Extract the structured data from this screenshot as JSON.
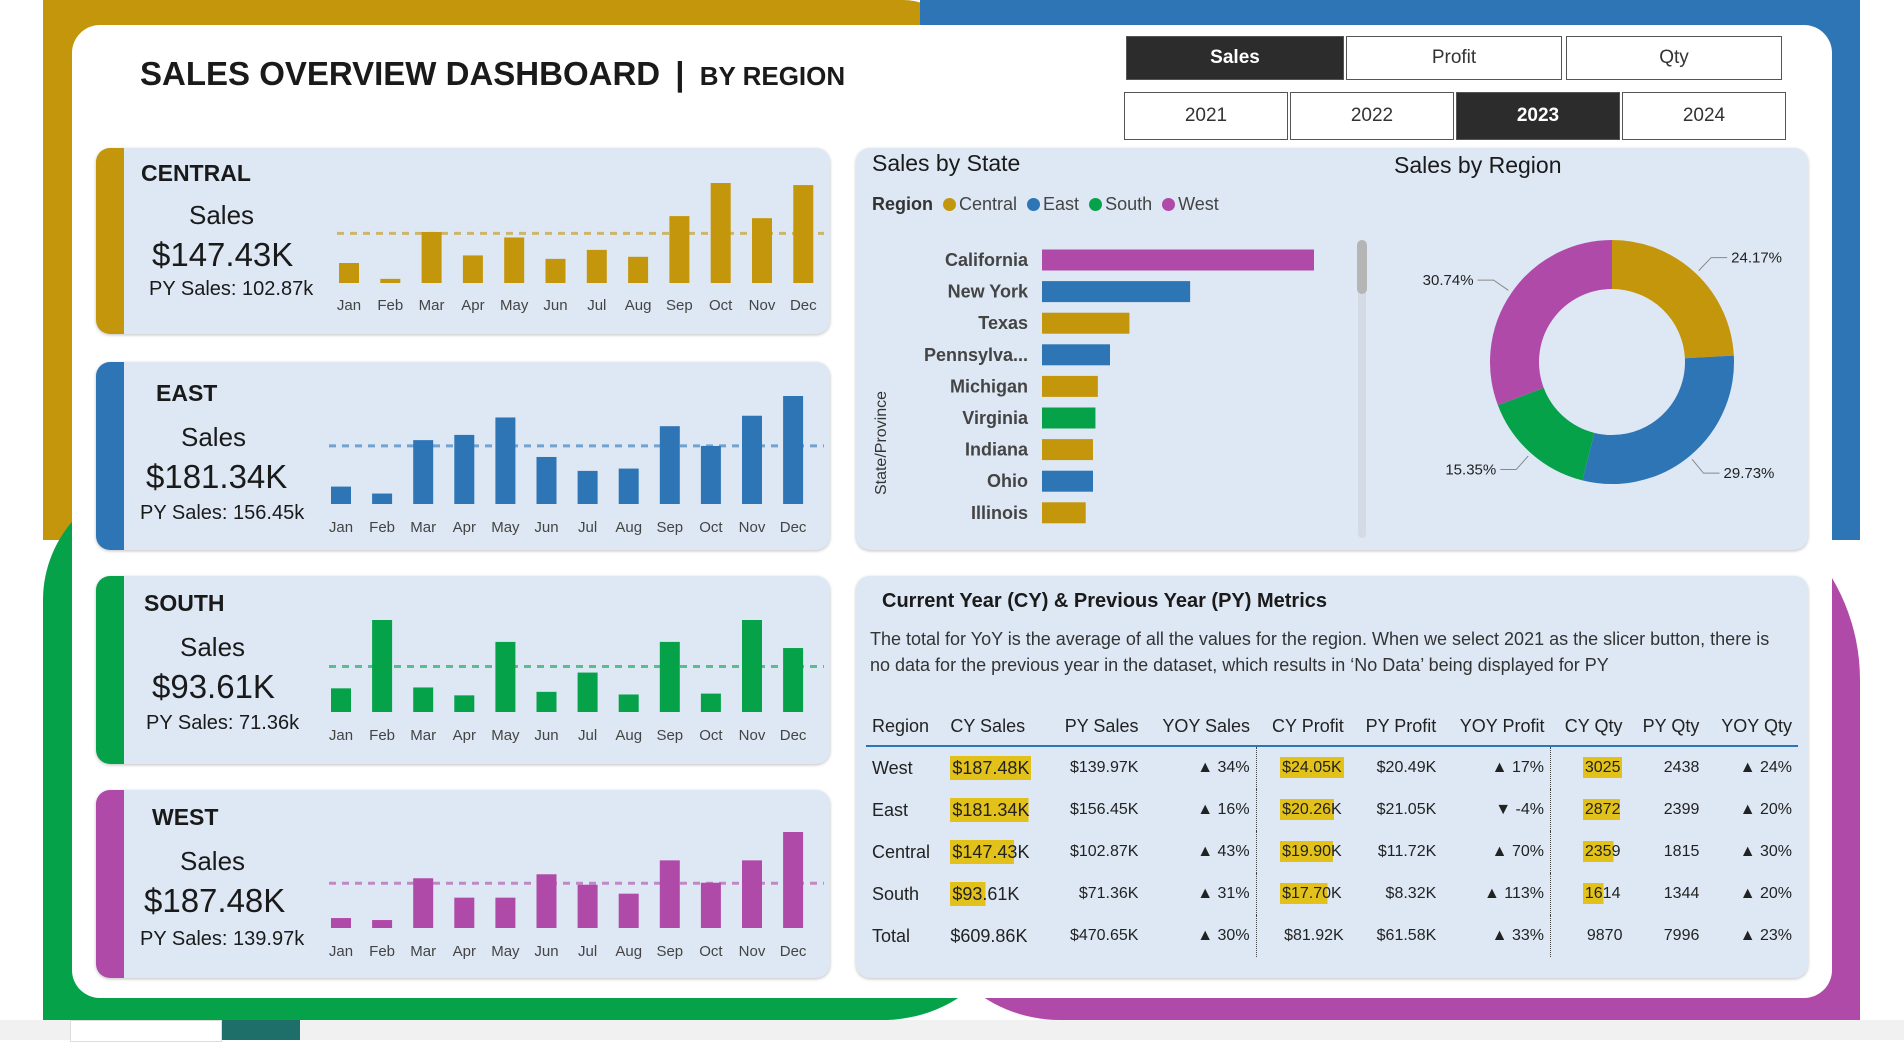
{
  "header": {
    "title": "SALES OVERVIEW DASHBOARD",
    "divider": "|",
    "subtitle": "BY REGION"
  },
  "slicers": {
    "measures": [
      {
        "label": "Sales",
        "selected": true
      },
      {
        "label": "Profit",
        "selected": false
      },
      {
        "label": "Qty",
        "selected": false
      }
    ],
    "years": [
      {
        "label": "2021",
        "selected": false
      },
      {
        "label": "2022",
        "selected": false
      },
      {
        "label": "2023",
        "selected": true
      },
      {
        "label": "2024",
        "selected": false
      }
    ]
  },
  "colors": {
    "central": "#c4960c",
    "east": "#2e75b6",
    "south": "#06a24a",
    "west": "#b04aa8",
    "highlight": "#e2c21a"
  },
  "chart_data": [
    {
      "type": "bar",
      "name": "CENTRAL",
      "metric_label": "Sales",
      "value": "$147.43K",
      "py": "PY Sales: 102.87k",
      "categories": [
        "Jan",
        "Feb",
        "Mar",
        "Apr",
        "May",
        "Jun",
        "Jul",
        "Aug",
        "Sep",
        "Oct",
        "Nov",
        "Dec"
      ],
      "values": [
        2.9,
        0.6,
        7.4,
        4.0,
        6.6,
        3.5,
        4.8,
        3.8,
        9.7,
        14.5,
        9.4,
        14.2
      ],
      "reference_line": 7.2,
      "color": "#c4960c"
    },
    {
      "type": "bar",
      "name": "EAST",
      "metric_label": "Sales",
      "value": "$181.34K",
      "py": "PY Sales: 156.45k",
      "categories": [
        "Jan",
        "Feb",
        "Mar",
        "Apr",
        "May",
        "Jun",
        "Jul",
        "Aug",
        "Sep",
        "Oct",
        "Nov",
        "Dec"
      ],
      "values": [
        3.0,
        1.8,
        11.0,
        11.9,
        14.9,
        8.1,
        5.7,
        6.1,
        13.4,
        10.0,
        15.2,
        18.6
      ],
      "reference_line": 10.0,
      "color": "#2e75b6"
    },
    {
      "type": "bar",
      "name": "SOUTH",
      "metric_label": "Sales",
      "value": "$93.61K",
      "py": "PY Sales: 71.36k",
      "categories": [
        "Jan",
        "Feb",
        "Mar",
        "Apr",
        "May",
        "Jun",
        "Jul",
        "Aug",
        "Sep",
        "Oct",
        "Nov",
        "Dec"
      ],
      "values": [
        2.7,
        10.5,
        2.8,
        1.9,
        8.0,
        2.3,
        4.5,
        2.0,
        8.0,
        2.1,
        10.5,
        7.3
      ],
      "reference_line": 5.2,
      "color": "#06a24a"
    },
    {
      "type": "bar",
      "name": "WEST",
      "metric_label": "Sales",
      "value": "$187.48K",
      "py": "PY Sales: 139.97k",
      "categories": [
        "Jan",
        "Feb",
        "Mar",
        "Apr",
        "May",
        "Jun",
        "Jul",
        "Aug",
        "Sep",
        "Oct",
        "Nov",
        "Dec"
      ],
      "values": [
        2.0,
        1.6,
        10.0,
        6.1,
        6.1,
        10.8,
        8.7,
        6.9,
        13.6,
        9.1,
        13.6,
        19.3
      ],
      "reference_line": 9.0,
      "color": "#b04aa8"
    },
    {
      "type": "bar",
      "title": "Sales by State",
      "ylabel": "State/Province",
      "legend_title": "Region",
      "legend": [
        {
          "name": "Central",
          "color": "#c4960c"
        },
        {
          "name": "East",
          "color": "#2e75b6"
        },
        {
          "name": "South",
          "color": "#06a24a"
        },
        {
          "name": "West",
          "color": "#b04aa8"
        }
      ],
      "categories": [
        "California",
        "New York",
        "Texas",
        "Pennsylva...",
        "Michigan",
        "Virginia",
        "Indiana",
        "Ohio",
        "Illinois"
      ],
      "values": [
        112,
        61,
        36,
        28,
        23,
        22,
        21,
        21,
        18
      ],
      "colors": [
        "#b04aa8",
        "#2e75b6",
        "#c4960c",
        "#2e75b6",
        "#c4960c",
        "#06a24a",
        "#c4960c",
        "#2e75b6",
        "#c4960c"
      ]
    },
    {
      "type": "pie",
      "title": "Sales by Region",
      "slices": [
        {
          "name": "Central",
          "value": 24.17,
          "label": "24.17%",
          "color": "#c4960c"
        },
        {
          "name": "East",
          "value": 29.73,
          "label": "29.73%",
          "color": "#2e75b6"
        },
        {
          "name": "South",
          "value": 15.35,
          "label": "15.35%",
          "color": "#06a24a"
        },
        {
          "name": "West",
          "value": 30.74,
          "label": "30.74%",
          "color": "#b04aa8"
        }
      ]
    }
  ],
  "metrics": {
    "title": "Current Year (CY) & Previous Year (PY) Metrics",
    "description": "The total for YoY is the average of all the values for the region. When we select 2021 as the slicer button, there is no data for the previous year in the dataset, which results in ‘No Data’ being displayed for PY",
    "columns": [
      "Region",
      "CY Sales",
      "PY Sales",
      "YOY Sales",
      "CY Profit",
      "PY Profit",
      "YOY Profit",
      "CY Qty",
      "PY Qty",
      "YOY Qty"
    ],
    "rows": [
      {
        "region": "West",
        "cy_sales": "$187.48K",
        "cy_sales_pct": 100,
        "py_sales": "$139.97K",
        "yoy_sales": "▲ 34%",
        "cy_profit": "$24.05K",
        "cy_profit_pct": 100,
        "py_profit": "$20.49K",
        "yoy_profit": "▲ 17%",
        "cy_qty": "3025",
        "cy_qty_pct": 100,
        "py_qty": "2438",
        "yoy_qty": "▲ 24%"
      },
      {
        "region": "East",
        "cy_sales": "$181.34K",
        "cy_sales_pct": 97,
        "py_sales": "$156.45K",
        "yoy_sales": "▲ 16%",
        "cy_profit": "$20.26K",
        "cy_profit_pct": 84,
        "py_profit": "$21.05K",
        "yoy_profit": "▼ -4%",
        "cy_qty": "2872",
        "cy_qty_pct": 95,
        "py_qty": "2399",
        "yoy_qty": "▲ 20%"
      },
      {
        "region": "Central",
        "cy_sales": "$147.43K",
        "cy_sales_pct": 79,
        "py_sales": "$102.87K",
        "yoy_sales": "▲ 43%",
        "cy_profit": "$19.90K",
        "cy_profit_pct": 83,
        "py_profit": "$11.72K",
        "yoy_profit": "▲ 70%",
        "cy_qty": "2359",
        "cy_qty_pct": 78,
        "py_qty": "1815",
        "yoy_qty": "▲ 30%"
      },
      {
        "region": "South",
        "cy_sales": "$93.61K",
        "cy_sales_pct": 50,
        "py_sales": "$71.36K",
        "yoy_sales": "▲ 31%",
        "cy_profit": "$17.70K",
        "cy_profit_pct": 74,
        "py_profit": "$8.32K",
        "yoy_profit": "▲ 113%",
        "cy_qty": "1614",
        "cy_qty_pct": 53,
        "py_qty": "1344",
        "yoy_qty": "▲ 20%"
      }
    ],
    "total": {
      "region": "Total",
      "cy_sales": "$609.86K",
      "py_sales": "$470.65K",
      "yoy_sales": "▲ 30%",
      "cy_profit": "$81.92K",
      "py_profit": "$61.58K",
      "yoy_profit": "▲ 33%",
      "cy_qty": "9870",
      "py_qty": "7996",
      "yoy_qty": "▲ 23%"
    }
  }
}
